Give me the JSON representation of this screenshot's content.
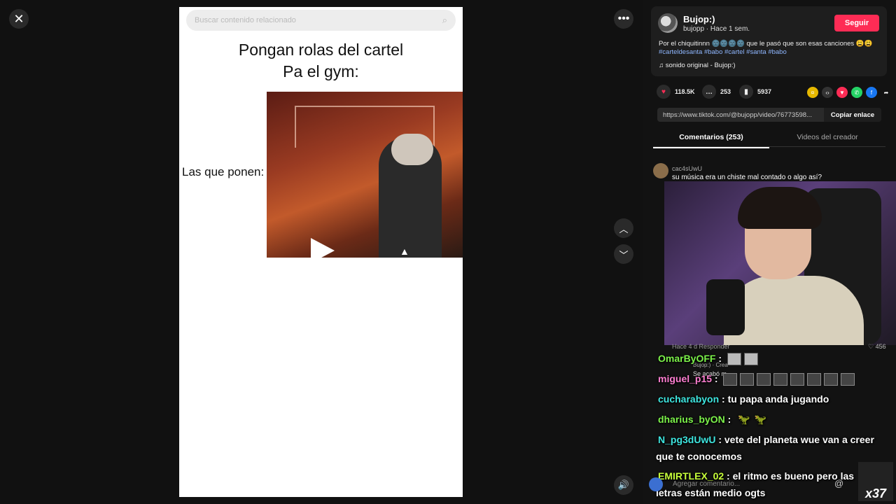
{
  "player": {
    "search_placeholder": "Buscar contenido relacionado",
    "title_line1": "Pongan rolas del cartel",
    "title_line2": "Pa el gym:",
    "left_caption": "Las que ponen:"
  },
  "author": {
    "name": "Bujop:)",
    "meta": "bujopp · Hace 1 sem.",
    "follow_label": "Seguir",
    "description": "Por el chiquitinnn 🌚🌚🌚🌚 que le pasó que son esas canciones 😩😩",
    "hashtags": "#carteldesanta #babo #cartel #santa #babo",
    "sound": "♫  sonido original - Bujop:)"
  },
  "stats": {
    "likes": "118.5K",
    "comments": "253",
    "saves": "5937"
  },
  "link": {
    "url": "https://www.tiktok.com/@bujopp/video/76773598...",
    "copy_label": "Copiar enlace"
  },
  "tabs": {
    "comments": "Comentarios (253)",
    "creator_videos": "Videos del creador"
  },
  "first_comment": {
    "user": "cac4sUwU",
    "text": "su música era un chiste mal contado o algo así?"
  },
  "hidden_comment": {
    "meta": "Hace 4 d   Responder",
    "likes": "456",
    "reply_user": "Bujop:) · Crea",
    "reply_text": "Se acabó m"
  },
  "chat": [
    {
      "user": "OmarByOFF",
      "color": "#7cf24a",
      "text": ":"
    },
    {
      "user": "miguel_p15",
      "color": "#ff7fd2",
      "text": ":"
    },
    {
      "user": "cucharabyon",
      "color": "#3ee6e0",
      "text": ": tu papa anda jugando"
    },
    {
      "user": "dharius_byON",
      "color": "#7cf24a",
      "text": ":"
    },
    {
      "user": "N_pg3dUwU",
      "color": "#3ee6e0",
      "text": ": vete del planeta wue van a creer"
    },
    {
      "user": "",
      "color": "#ffffff",
      "text": "que te conocemos"
    },
    {
      "user": "EMIRTLEX_02",
      "color": "#c7ff3a",
      "text": ": el ritmo es bueno pero las"
    },
    {
      "user": "",
      "color": "#ffffff",
      "text": "letras están medio ogts"
    }
  ],
  "comment_input": {
    "placeholder": "Agregar comentario..."
  },
  "badge": "x37"
}
